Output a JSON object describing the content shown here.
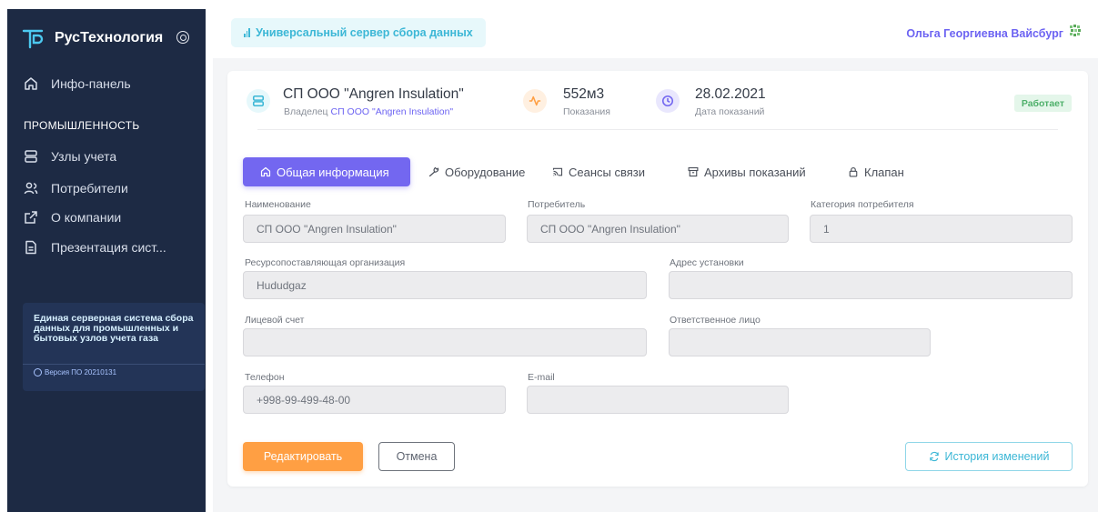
{
  "sidebar": {
    "brand": "РусТехнология",
    "nav_top": [
      {
        "label": "Инфо-панель",
        "icon": "home-icon"
      }
    ],
    "section_title": "ПРОМЫШЛЕННОСТЬ",
    "nav_items": [
      {
        "label": "Узлы учета",
        "icon": "server-icon"
      },
      {
        "label": "Потребители",
        "icon": "users-icon"
      },
      {
        "label": "О компании",
        "icon": "external-link-icon"
      },
      {
        "label": "Презентация сист...",
        "icon": "document-icon"
      }
    ],
    "info_card": {
      "text": "Единая серверная система сбора данных для промышленных и бытовых узлов учета газа",
      "version": "Версия ПО 20210131"
    }
  },
  "header": {
    "server_title": "Универсальный сервер сбора данных",
    "user_name": "Ольга Георгиевна Вайсбург"
  },
  "summary": {
    "name": "СП ООО \"Angren Insulation\"",
    "owner_prefix": "Владелец",
    "owner_link": "СП ООО \"Angren Insulation\"",
    "reading_value": "552м3",
    "reading_label": "Показания",
    "date_value": "28.02.2021",
    "date_label": "Дата показаний",
    "status": "Работает"
  },
  "tabs": [
    {
      "label": "Общая информация",
      "icon": "home-icon",
      "active": true
    },
    {
      "label": "Оборудование",
      "icon": "wrench-icon"
    },
    {
      "label": "Сеансы связи",
      "icon": "cast-icon"
    },
    {
      "label": "Архивы показаний",
      "icon": "archive-icon"
    },
    {
      "label": "Клапан",
      "icon": "lock-icon"
    }
  ],
  "form": {
    "name_label": "Наименование",
    "name_value": "СП ООО \"Angren Insulation\"",
    "consumer_label": "Потребитель",
    "consumer_value": "СП ООО \"Angren Insulation\"",
    "category_label": "Категория потребителя",
    "category_value": "1",
    "resource_org_label": "Ресурсопоставляющая организация",
    "resource_org_value": "Hududgaz",
    "address_label": "Адрес установки",
    "address_value": "",
    "account_label": "Лицевой счет",
    "account_value": "",
    "responsible_label": "Ответственное лицо",
    "responsible_value": "",
    "phone_label": "Телефон",
    "phone_value": "+998-99-499-48-00",
    "email_label": "E-mail",
    "email_value": ""
  },
  "actions": {
    "edit": "Редактировать",
    "cancel": "Отмена",
    "history": "История изменений"
  },
  "colors": {
    "sidebar_bg": "#1d2a44",
    "accent_purple": "#7367f0",
    "accent_orange": "#ff9f43",
    "accent_cyan": "#3cb7d6",
    "status_green": "#4fb06b"
  }
}
